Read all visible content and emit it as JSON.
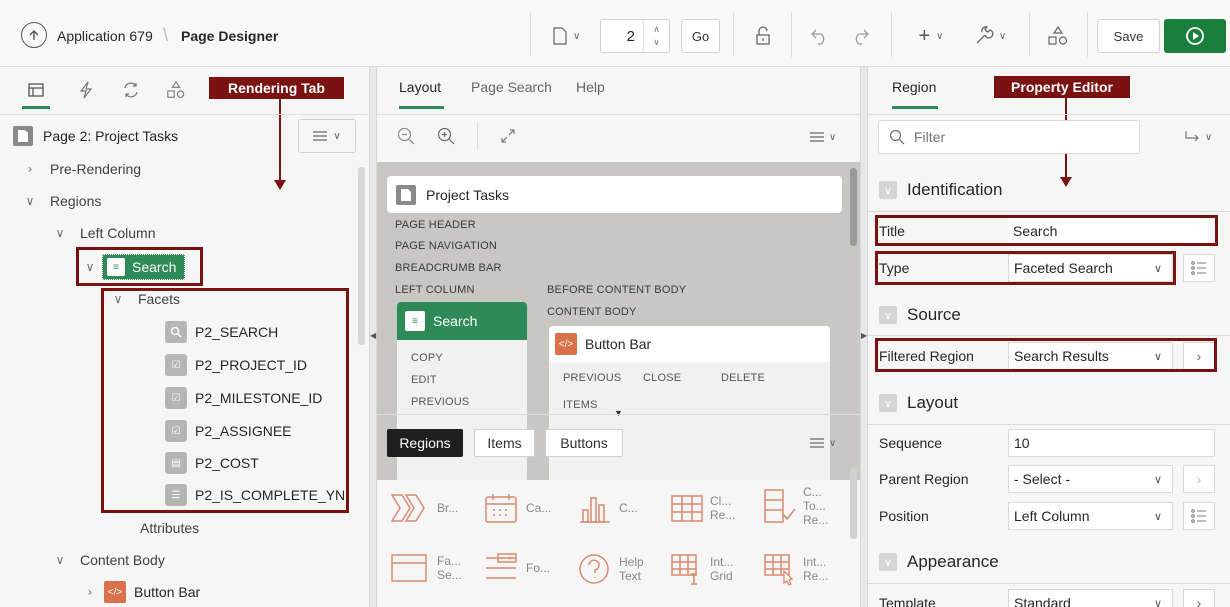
{
  "topbar": {
    "app_label": "Application 679",
    "page_designer_label": "Page Designer",
    "page_number": "2",
    "go_label": "Go",
    "save_label": "Save"
  },
  "left": {
    "callout": "Rendering Tab",
    "page_title": "Page 2: Project Tasks",
    "tree": {
      "pre_rendering": "Pre-Rendering",
      "regions": "Regions",
      "left_column": "Left Column",
      "search": "Search",
      "facets": "Facets",
      "items": [
        "P2_SEARCH",
        "P2_PROJECT_ID",
        "P2_MILESTONE_ID",
        "P2_ASSIGNEE",
        "P2_COST",
        "P2_IS_COMPLETE_YN"
      ],
      "attributes": "Attributes",
      "content_body": "Content Body",
      "button_bar": "Button Bar"
    }
  },
  "middle": {
    "tabs": [
      "Layout",
      "Page Search",
      "Help"
    ],
    "layout": {
      "page_title": "Project Tasks",
      "labels": [
        "PAGE HEADER",
        "PAGE NAVIGATION",
        "BREADCRUMB BAR",
        "LEFT COLUMN",
        "BEFORE CONTENT BODY",
        "CONTENT BODY"
      ],
      "search_region": "Search",
      "search_positions": [
        "COPY",
        "EDIT",
        "PREVIOUS"
      ],
      "button_bar": "Button Bar",
      "button_positions": [
        "PREVIOUS",
        "CLOSE",
        "DELETE",
        "ITEMS"
      ]
    },
    "gallery": {
      "tabs": [
        "Regions",
        "Items",
        "Buttons"
      ],
      "items": [
        {
          "icon": "breadcrumb-icon",
          "label": "Br..."
        },
        {
          "icon": "calendar-icon",
          "label": "Ca..."
        },
        {
          "icon": "chart-icon",
          "label": "C..."
        },
        {
          "icon": "classic-report-icon",
          "label": "Cl... Re..."
        },
        {
          "icon": "column-toggle-icon",
          "label": "C... To... Re..."
        },
        {
          "icon": "faceted-search-icon",
          "label": "Fa... Se..."
        },
        {
          "icon": "form-icon",
          "label": "Fo..."
        },
        {
          "icon": "help-icon",
          "label": "Help Text"
        },
        {
          "icon": "interactive-grid-icon",
          "label": "Int... Grid"
        },
        {
          "icon": "interactive-report-icon",
          "label": "Int... Re..."
        }
      ]
    }
  },
  "right": {
    "tab": "Region",
    "callout": "Property Editor",
    "filter_placeholder": "Filter",
    "sections": {
      "identification": "Identification",
      "source": "Source",
      "layout": "Layout",
      "appearance": "Appearance"
    },
    "props": {
      "title_label": "Title",
      "title_value": "Search",
      "type_label": "Type",
      "type_value": "Faceted Search",
      "filtered_label": "Filtered Region",
      "filtered_value": "Search Results",
      "sequence_label": "Sequence",
      "sequence_value": "10",
      "parent_label": "Parent Region",
      "parent_value": "- Select -",
      "position_label": "Position",
      "position_value": "Left Column",
      "template_label": "Template",
      "template_value": "Standard"
    }
  },
  "colors": {
    "accent_red": "#7a1212",
    "green": "#2e8b57",
    "run_green": "#1a7f3a",
    "orange": "#d9714a"
  }
}
